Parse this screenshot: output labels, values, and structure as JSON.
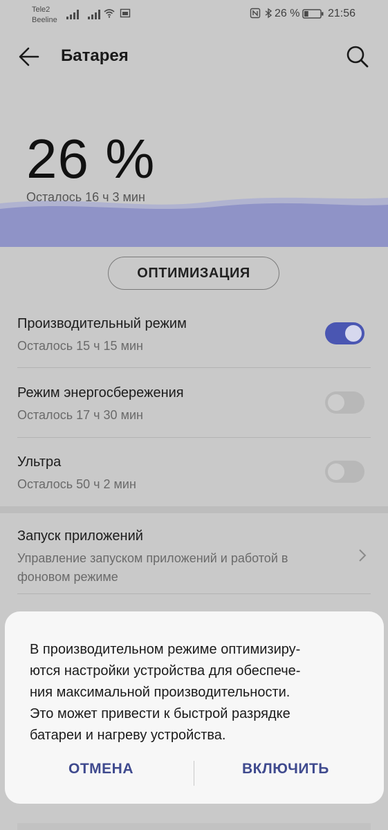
{
  "status_bar": {
    "carrier1": "Tele2",
    "carrier2": "Beeline",
    "battery_percent": "26 %",
    "time": "21:56",
    "icons": [
      "signal-icon",
      "signal-icon",
      "wifi-icon",
      "sim-icon",
      "nfc-icon",
      "bluetooth-icon",
      "battery-icon"
    ]
  },
  "appbar": {
    "title": "Батарея",
    "back_icon": "arrow-left-icon",
    "search_icon": "search-icon"
  },
  "battery": {
    "percent": "26 %",
    "remaining": "Осталось 16 ч 3 мин",
    "level": 0.26,
    "wave_color": "#8f93c7"
  },
  "optimize_label": "ОПТИМИЗАЦИЯ",
  "modes": [
    {
      "title": "Производительный режим",
      "subtitle": "Осталось 15 ч 15 мин",
      "enabled": true
    },
    {
      "title": "Режим энергосбережения",
      "subtitle": "Осталось 17 ч 30 мин",
      "enabled": false
    },
    {
      "title": "Ультра",
      "subtitle": "Осталось 50 ч 2 мин",
      "enabled": false
    }
  ],
  "app_launch": {
    "title": "Запуск приложений",
    "subtitle": "Управление запуском приложений и работой в\nфоновом режиме"
  },
  "dialog": {
    "message": "В производительном режиме оптимизиру-\nются настройки устройства для обеспече-\nния максимальной производительности.\nЭто может привести к быстрой разрядке\nбатареи и нагреву устройства.",
    "cancel_label": "ОТМЕНА",
    "enable_label": "ВКЛЮЧИТЬ"
  },
  "colors": {
    "accent": "#4a56b2",
    "dialog_button": "#3f4a8e",
    "scrim_background": "#c9c9c9"
  }
}
